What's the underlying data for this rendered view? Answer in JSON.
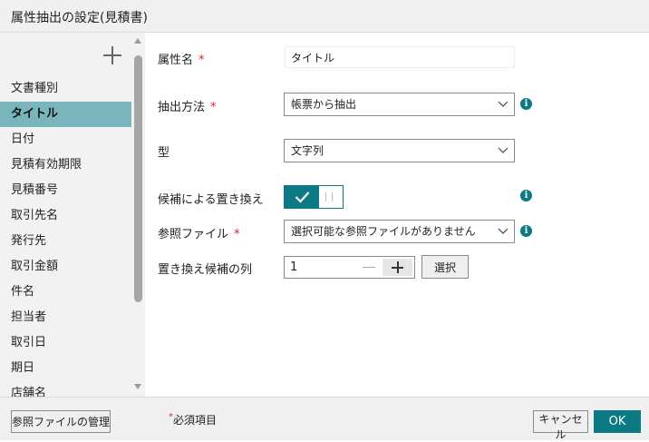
{
  "window": {
    "title": "属性抽出の設定(見積書)"
  },
  "sidebar": {
    "add_icon": "plus-icon",
    "selected_index": 1,
    "items": [
      {
        "label": "文書種別"
      },
      {
        "label": "タイトル"
      },
      {
        "label": "日付"
      },
      {
        "label": "見積有効期限"
      },
      {
        "label": "見積番号"
      },
      {
        "label": "取引先名"
      },
      {
        "label": "発行先"
      },
      {
        "label": "取引金額"
      },
      {
        "label": "件名"
      },
      {
        "label": "担当者"
      },
      {
        "label": "取引日"
      },
      {
        "label": "期日"
      },
      {
        "label": "店舗名"
      }
    ]
  },
  "form": {
    "attr_name": {
      "label": "属性名",
      "required_mark": "*",
      "value": "タイトル"
    },
    "extraction_method": {
      "label": "抽出方法",
      "required_mark": "*",
      "value": "帳票から抽出"
    },
    "type": {
      "label": "型",
      "value": "文字列"
    },
    "candidate_replace": {
      "label": "候補による置き換え",
      "on": true
    },
    "reference_file": {
      "label": "参照ファイル",
      "required_mark": "*",
      "value": "選択可能な参照ファイルがありません"
    },
    "replace_column": {
      "label": "置き換え候補の列",
      "value": "1",
      "select_label": "選択"
    }
  },
  "footer": {
    "manage_label": "参照ファイルの管理",
    "required_note_mark": "*",
    "required_note": "必須項目",
    "cancel_label": "キャンセル",
    "ok_label": "OK"
  },
  "colors": {
    "accent": "#0b7a85",
    "selected_row": "#7ab5bd",
    "required": "#d9262c"
  }
}
